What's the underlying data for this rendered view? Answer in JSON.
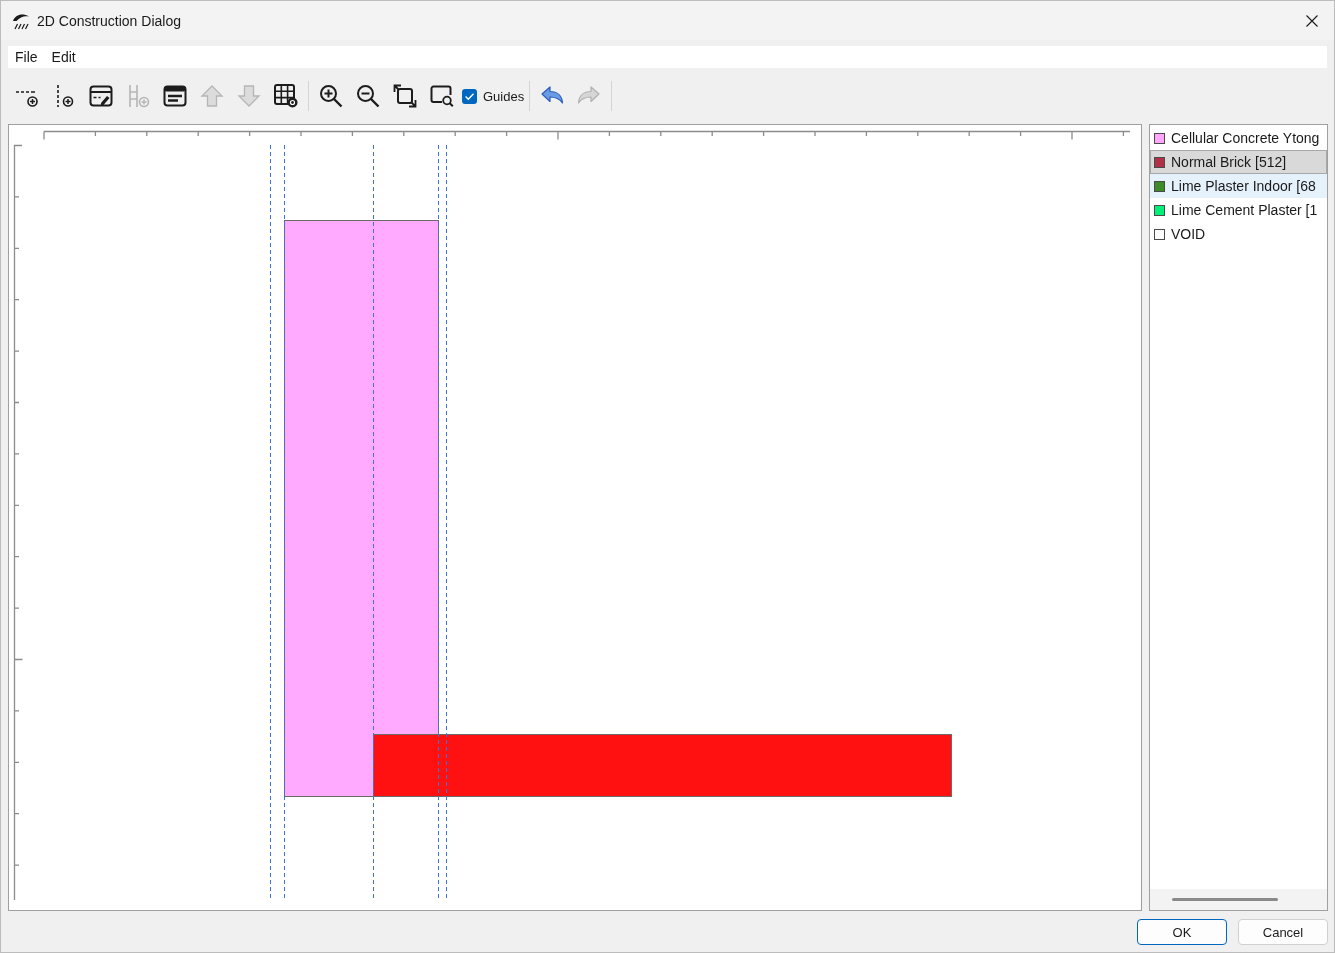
{
  "window": {
    "title": "2D Construction Dialog"
  },
  "menu": [
    "File",
    "Edit"
  ],
  "toolbar": [
    {
      "kind": "button",
      "disabled": false
    },
    {
      "kind": "button",
      "disabled": false
    },
    {
      "kind": "button",
      "disabled": false
    },
    {
      "kind": "button",
      "disabled": true
    },
    {
      "kind": "button",
      "disabled": false
    },
    {
      "kind": "button",
      "disabled": true
    },
    {
      "kind": "button",
      "disabled": true
    },
    {
      "kind": "button",
      "disabled": false
    },
    {
      "kind": "separator"
    },
    {
      "kind": "button",
      "disabled": false
    },
    {
      "kind": "button",
      "disabled": false
    },
    {
      "kind": "button",
      "disabled": false
    },
    {
      "kind": "button",
      "disabled": false
    },
    {
      "kind": "checkbox",
      "label": "Guides",
      "checked": true
    },
    {
      "kind": "separator"
    },
    {
      "kind": "button",
      "disabled": false
    },
    {
      "kind": "button",
      "disabled": true
    },
    {
      "kind": "separator"
    }
  ],
  "canvas": {
    "shapes": [
      {
        "color": "#ffaaff"
      },
      {
        "color": "#ff1111"
      }
    ]
  },
  "materials": [
    {
      "label": "Cellular Concrete Ytong",
      "color": "#ffa6ff",
      "selected": false,
      "hovered": false
    },
    {
      "label": "Normal Brick [512]",
      "color": "#b03048",
      "selected": true,
      "hovered": false
    },
    {
      "label": "Lime Plaster Indoor [68",
      "color": "#3c8a28",
      "selected": false,
      "hovered": true
    },
    {
      "label": "Lime Cement Plaster [1",
      "color": "#00f07a",
      "selected": false,
      "hovered": false
    },
    {
      "label": "VOID",
      "color": "#ffffff",
      "selected": false,
      "hovered": false
    }
  ],
  "buttons": [
    {
      "label": "OK",
      "default": true
    },
    {
      "label": "Cancel",
      "default": false
    }
  ]
}
